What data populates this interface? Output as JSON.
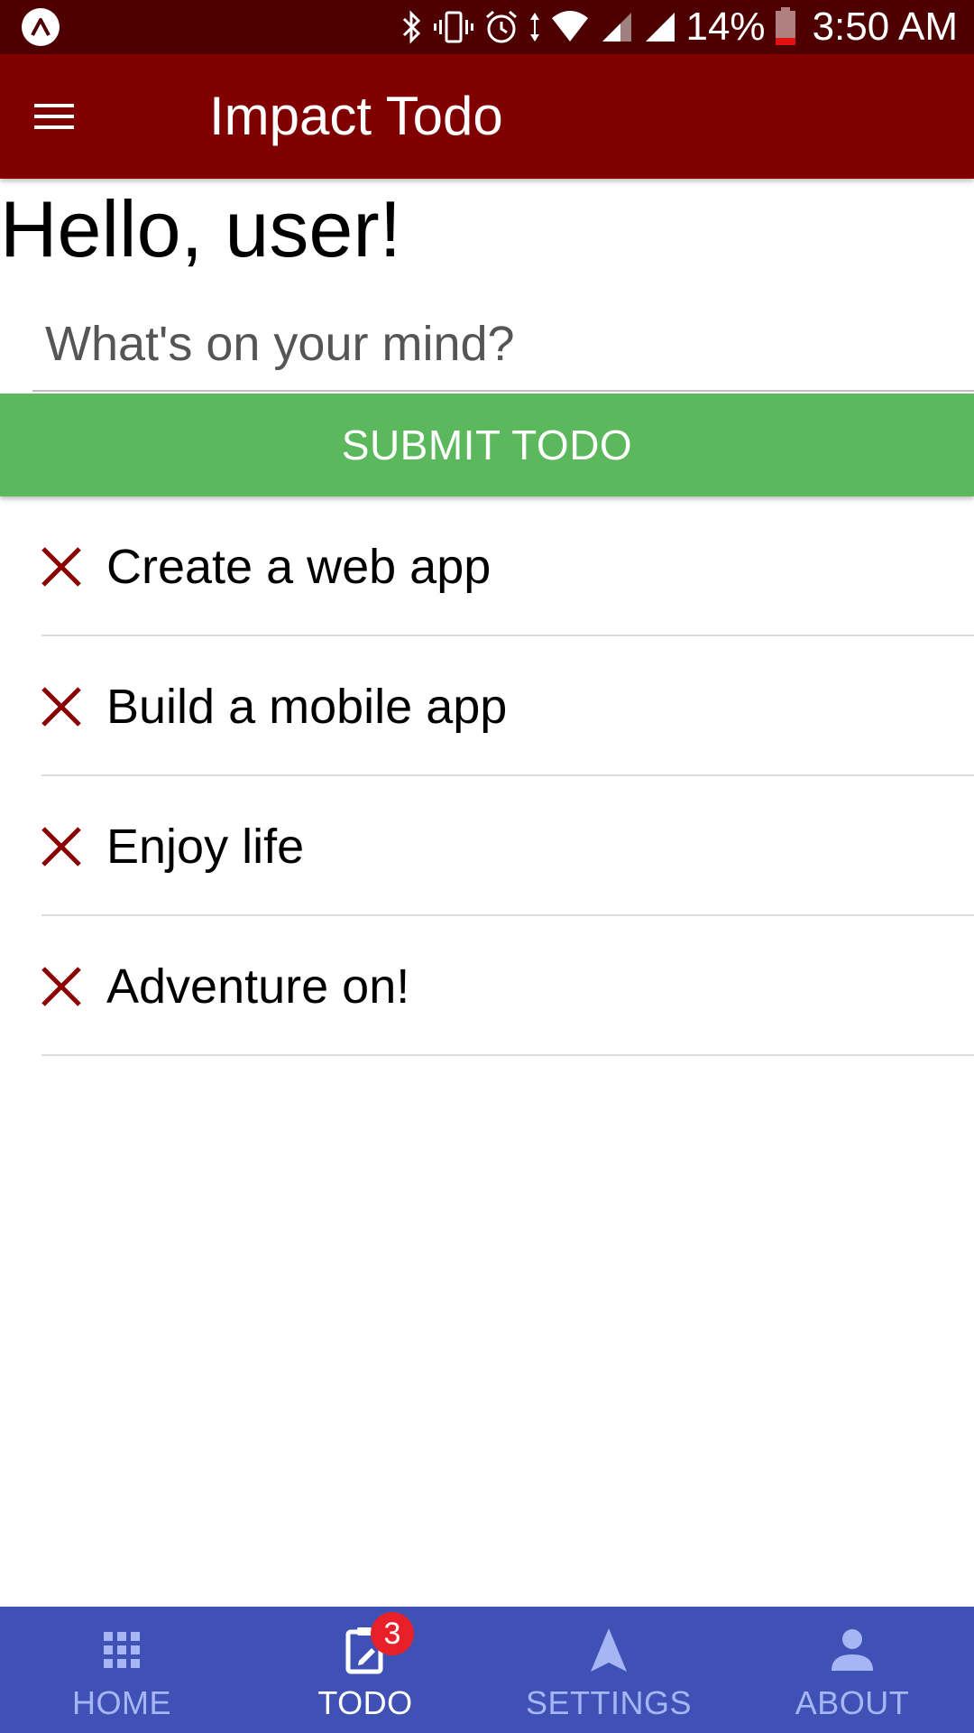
{
  "status_bar": {
    "battery_percent": "14%",
    "time": "3:50 AM",
    "icons": [
      "expo-icon",
      "bluetooth-icon",
      "vibrate-icon",
      "alarm-icon",
      "data-arrows-icon",
      "wifi-icon",
      "signal-icon",
      "signal-icon",
      "battery-low-icon"
    ]
  },
  "app_bar": {
    "title": "Impact Todo",
    "menu_icon": "hamburger-menu-icon",
    "background_color": "#800000"
  },
  "main": {
    "greeting": "Hello, user!",
    "input": {
      "placeholder": "What's on your mind?",
      "value": ""
    },
    "submit_label": "SUBMIT TODO",
    "submit_color": "#5cb85c",
    "todos": [
      {
        "text": "Create a web app"
      },
      {
        "text": "Build a mobile app"
      },
      {
        "text": "Enjoy life"
      },
      {
        "text": "Adventure on!"
      }
    ],
    "delete_icon": "close-x-icon",
    "delete_icon_color": "#8b0000"
  },
  "bottom_nav": {
    "background_color": "#3f51b5",
    "items": [
      {
        "label": "HOME",
        "icon": "grid-apps-icon",
        "active": false
      },
      {
        "label": "TODO",
        "icon": "clipboard-edit-icon",
        "active": true,
        "badge": "3"
      },
      {
        "label": "SETTINGS",
        "icon": "navigation-arrow-icon",
        "active": false
      },
      {
        "label": "ABOUT",
        "icon": "person-icon",
        "active": false
      }
    ]
  }
}
